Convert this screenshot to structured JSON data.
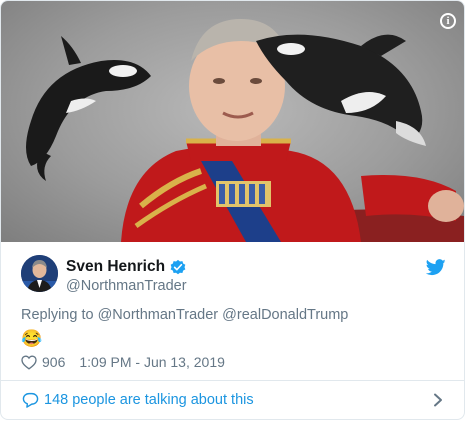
{
  "media": {
    "alt_icon": "info-icon",
    "info_glyph": "i"
  },
  "tweet": {
    "display_name": "Sven Henrich",
    "handle": "@NorthmanTrader",
    "verified_icon": "verified-badge-icon",
    "platform_icon": "twitter-bird-icon",
    "reply_prefix": "Replying to",
    "reply_to": [
      "@NorthmanTrader",
      "@realDonaldTrump"
    ],
    "text": "😂",
    "like_icon": "heart-icon",
    "likes": "906",
    "timestamp": "1:09 PM - Jun 13, 2019"
  },
  "footer": {
    "icon": "comment-icon",
    "label": "148 people are talking about this",
    "chevron": "chevron-right-icon"
  },
  "colors": {
    "link_blue": "#1b95e0",
    "muted": "#657786",
    "border": "#e1e8ed",
    "verified_blue": "#1da1f2"
  }
}
